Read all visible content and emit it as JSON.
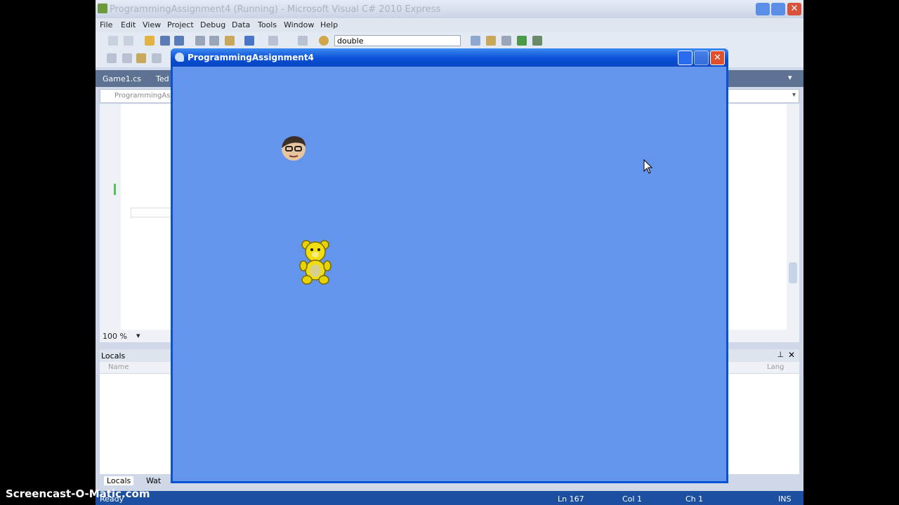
{
  "vs": {
    "title": "ProgrammingAssignment4 (Running) - Microsoft Visual C# 2010 Express",
    "menu": [
      "File",
      "Edit",
      "View",
      "Project",
      "Debug",
      "Data",
      "Tools",
      "Window",
      "Help"
    ],
    "toolbar": {
      "solution_config": "double"
    },
    "doc_tabs": [
      "Game1.cs",
      "Ted"
    ],
    "nav_dropdown": "ProgrammingAssi",
    "zoom": "100 %",
    "locals": {
      "title": "Locals",
      "col_name": "Name",
      "col_lang": "Lang"
    },
    "bottom_tabs": [
      "Locals",
      "Wat"
    ],
    "status": {
      "ready": "Ready",
      "ln": "Ln 167",
      "col": "Col 1",
      "ch": "Ch 1",
      "ins": "INS"
    }
  },
  "game": {
    "title": "ProgrammingAssignment4",
    "background_color": "#6495ED",
    "sprites": [
      "face-sprite",
      "teddy-bear-sprite"
    ]
  },
  "watermark": "Screencast-O-Matic.com"
}
